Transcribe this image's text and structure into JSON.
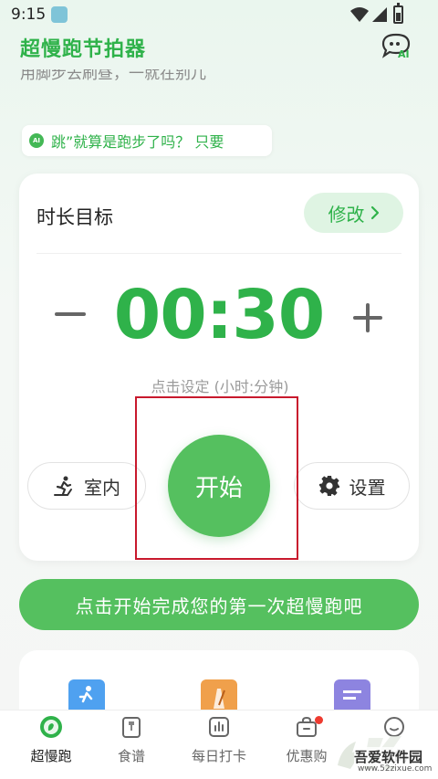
{
  "status_bar": {
    "time": "9:15"
  },
  "header": {
    "title": "超慢跑节拍器",
    "ai_icon_text": "AI"
  },
  "marquee_text": "用脚步去刷昼，一就在别儿",
  "ai_tip": {
    "badge": "AI",
    "text": "跳”就算是跑步了吗？ 只要"
  },
  "goal_card": {
    "label": "时长目标",
    "modify_label": "修改",
    "time": "00:30",
    "hint": "点击设定 (小时:分钟)",
    "indoor_label": "室内",
    "start_label": "开始",
    "settings_label": "设置"
  },
  "cta_banner": "点击开始完成您的第一次超慢跑吧",
  "tabs": [
    {
      "label": "超慢跑"
    },
    {
      "label": "食谱"
    },
    {
      "label": "每日打卡"
    },
    {
      "label": "优惠购"
    },
    {
      "label": "我的"
    }
  ],
  "watermark": {
    "title": "吾爱软件园",
    "url": "www.52zixue.com"
  },
  "colors": {
    "accent": "#2fb24a",
    "button": "#55c05f",
    "highlight": "#c8192d"
  }
}
